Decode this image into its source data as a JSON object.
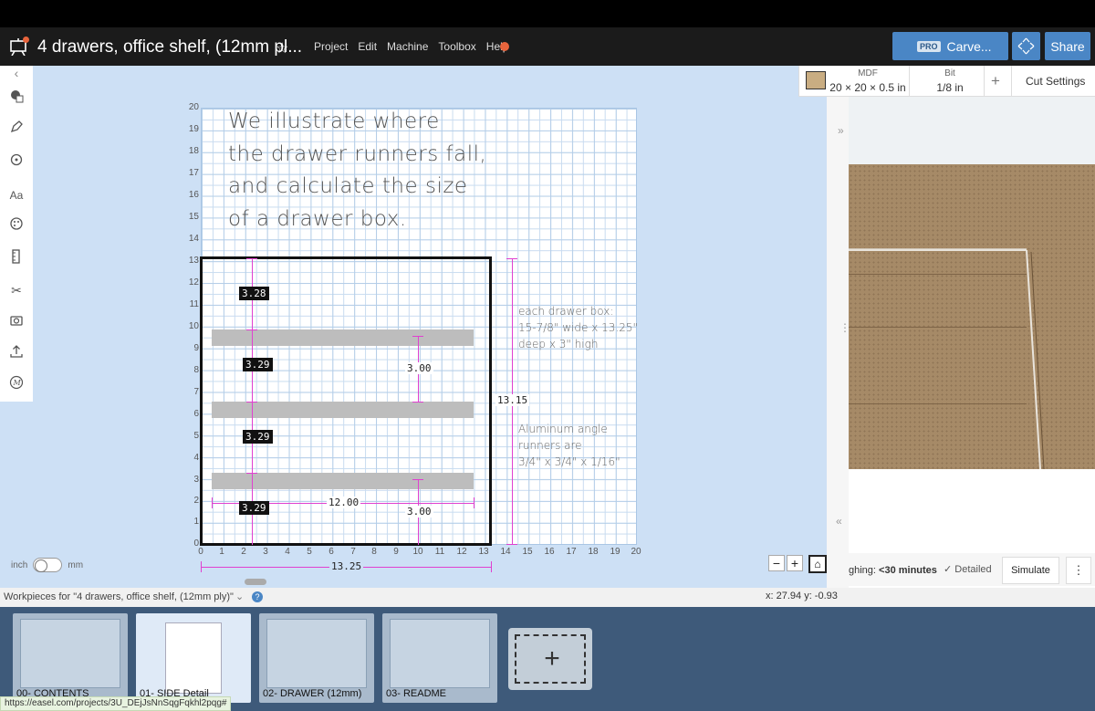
{
  "header": {
    "title": "4 drawers, office shelf, (12mm pl...",
    "menu": [
      "Project",
      "Edit",
      "Machine",
      "Toolbox",
      "Help"
    ],
    "pro_badge": "PRO",
    "carve_label": "Carve...",
    "share_label": "Share"
  },
  "material": {
    "material_label": "MDF",
    "material_size": "20 × 20 × 0.5 in",
    "bit_label": "Bit",
    "bit_value": "1/8 in",
    "add_symbol": "+",
    "cut_settings": "Cut Settings"
  },
  "tools": [
    "shape-icon",
    "pen-icon",
    "target-icon",
    "text-icon",
    "palette-icon",
    "ruler-icon",
    "scissors-icon",
    "camera-icon",
    "upload-icon",
    "apps-icon"
  ],
  "text_tool_label": "Aa",
  "canvas": {
    "y_ticks": [
      "20",
      "19",
      "18",
      "17",
      "16",
      "15",
      "14",
      "13",
      "12",
      "11",
      "10",
      "9",
      "8",
      "7",
      "6",
      "5",
      "4",
      "3",
      "2",
      "1",
      "0"
    ],
    "x_ticks": [
      "0",
      "1",
      "2",
      "3",
      "4",
      "5",
      "6",
      "7",
      "8",
      "9",
      "10",
      "11",
      "12",
      "13",
      "14",
      "15",
      "16",
      "17",
      "18",
      "19",
      "20"
    ],
    "note_lines": [
      "We illustrate where",
      "the drawer runners fall,",
      "and calculate the size",
      "of a drawer box."
    ],
    "box_note": [
      "each drawer box:",
      "15-7/8\" wide x 13.25\"",
      "deep x 3\" high"
    ],
    "runner_note": [
      "Aluminum angle",
      "runners are",
      "3/4\" x 3/4\" x 1/16\""
    ],
    "dims": {
      "d1": "3.28",
      "d2": "3.29",
      "d3": "3.29",
      "d4": "3.29",
      "mid_upper": "3.00",
      "mid_lower": "3.00",
      "width": "12.00",
      "height": "13.15",
      "bottom": "13.25"
    }
  },
  "units": {
    "left": "inch",
    "right": "mm"
  },
  "zoom": {
    "minus": "−",
    "plus": "+",
    "home": "⌂"
  },
  "simulation": {
    "roughing_prefix": "ghing: ",
    "roughing_value": "<30 minutes",
    "detailed": "Detailed",
    "simulate": "Simulate",
    "more": "⋮"
  },
  "workpieces": {
    "header": "Workpieces for \"4 drawers, office shelf, (12mm ply)\"",
    "coords": "x: 27.94 y: -0.93",
    "cards": [
      "00- CONTENTS",
      "01- SIDE Detail",
      "02- DRAWER (12mm)",
      "03- README"
    ],
    "add_symbol": "+"
  },
  "status_url": "https://easel.com/projects/3U_DEjJsNnSqgFqkhl2pqg#",
  "colors": {
    "accent": "#4a86c5",
    "notification": "#e8643c",
    "dimension": "#e040d0"
  }
}
